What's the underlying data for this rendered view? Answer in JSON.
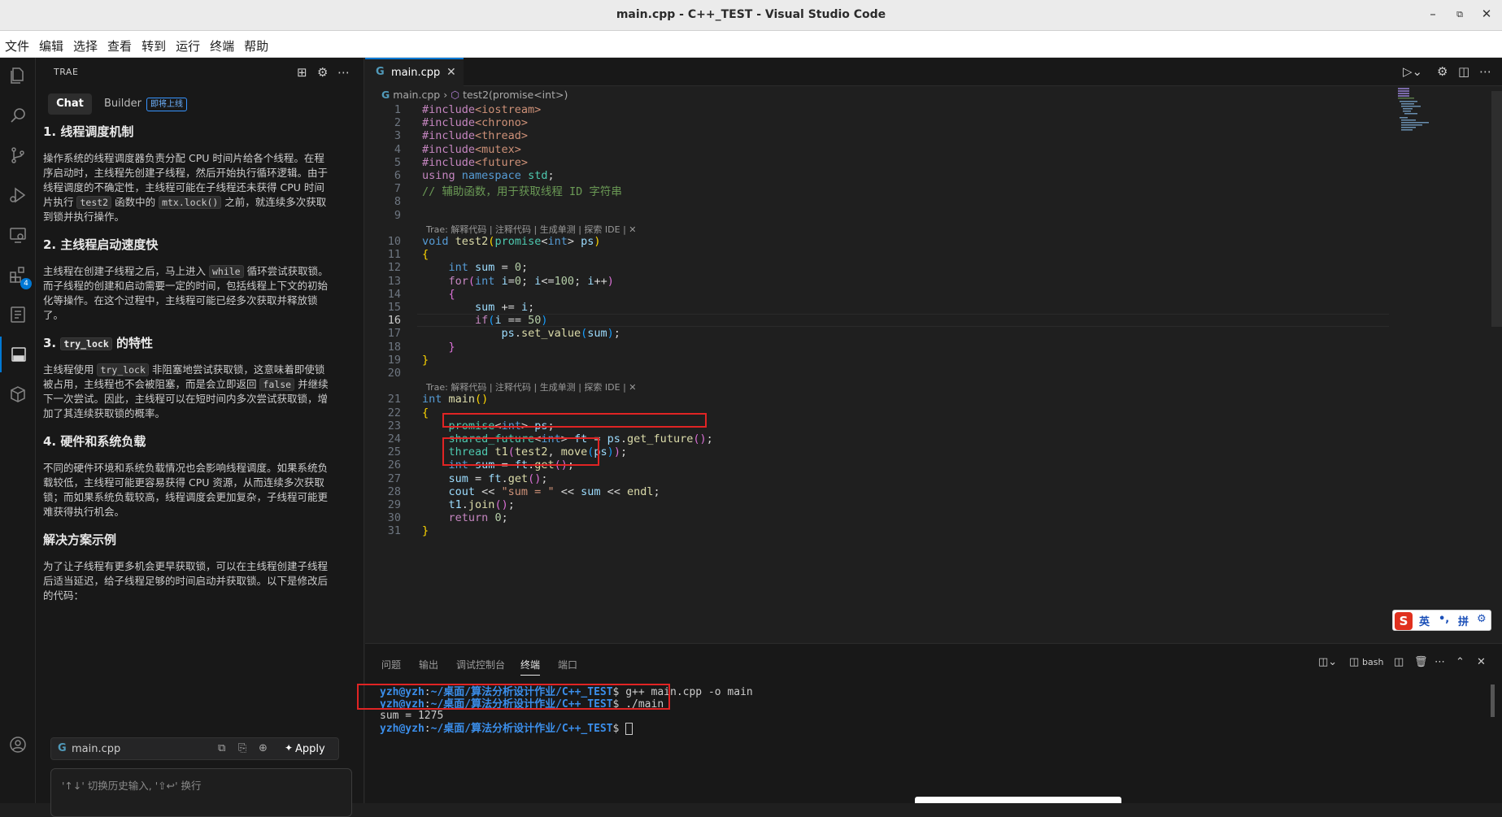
{
  "window": {
    "title": "main.cpp - C++_TEST - Visual Studio Code"
  },
  "menu": [
    "文件",
    "编辑",
    "选择",
    "查看",
    "转到",
    "运行",
    "终端",
    "帮助"
  ],
  "activity_badge": "4",
  "side": {
    "header": "TRAE",
    "tabs": {
      "chat": "Chat",
      "builder": "Builder",
      "builder_badge": "即将上线"
    },
    "sections": [
      {
        "title": "1. 线程调度机制",
        "body": [
          "操作系统的线程调度器负责分配 CPU 时间片给各个线程。在程序启动时，主线程先创建子线程，然后开始执行循环逻辑。由于线程调度的不确定性，主线程可能在子线程还未获得 CPU 时间片执行 ",
          "test2",
          " 函数中的 ",
          "mtx.lock()",
          " 之前，就连续多次获取到锁并执行操作。"
        ]
      },
      {
        "title": "2. 主线程启动速度快",
        "body": [
          "主线程在创建子线程之后，马上进入 ",
          "while",
          " 循环尝试获取锁。而子线程的创建和启动需要一定的时间，包括线程上下文的初始化等操作。在这个过程中，主线程可能已经多次获取并释放锁了。"
        ]
      },
      {
        "title_pre": "3. ",
        "title_code": "try_lock",
        "title_post": " 的特性",
        "body": [
          "主线程使用 ",
          "try_lock",
          " 非阻塞地尝试获取锁，这意味着即使锁被占用，主线程也不会被阻塞，而是会立即返回 ",
          "false",
          " 并继续下一次尝试。因此，主线程可以在短时间内多次尝试获取锁，增加了其连续获取锁的概率。"
        ]
      },
      {
        "title": "4. 硬件和系统负载",
        "body": [
          "不同的硬件环境和系统负载情况也会影响线程调度。如果系统负载较低，主线程可能更容易获得 CPU 资源，从而连续多次获取锁；而如果系统负载较高，线程调度会更加复杂，子线程可能更难获得执行机会。"
        ]
      },
      {
        "title": "解决方案示例",
        "body": [
          "为了让子线程有更多机会更早获取锁，可以在主线程创建子线程后适当延迟，给子线程足够的时间启动并获取锁。以下是修改后的代码："
        ]
      }
    ],
    "code_block": {
      "filename": "main.cpp",
      "apply": "Apply"
    },
    "input_placeholder": "'↑↓' 切换历史输入, '⇧↩' 换行"
  },
  "editor": {
    "tab": "main.cpp",
    "breadcrumb": {
      "file": "main.cpp",
      "symbol": "test2(promise<int>)"
    },
    "codelens": "Trae: 解释代码 | 注释代码 | 生成单测 | 探索 IDE | ✕",
    "current_line": 16,
    "lines": [
      {
        "n": "1",
        "html": "<span class='kc'>#include</span><span class='s'>&lt;iostream&gt;</span>"
      },
      {
        "n": "2",
        "html": "<span class='kc'>#include</span><span class='s'>&lt;chrono&gt;</span>"
      },
      {
        "n": "3",
        "html": "<span class='kc'>#include</span><span class='s'>&lt;thread&gt;</span>"
      },
      {
        "n": "4",
        "html": "<span class='kc'>#include</span><span class='s'>&lt;mutex&gt;</span>"
      },
      {
        "n": "5",
        "html": "<span class='kc'>#include</span><span class='s'>&lt;future&gt;</span>"
      },
      {
        "n": "6",
        "html": "<span class='kc'>using</span> <span class='k'>namespace</span> <span class='t'>std</span>;"
      },
      {
        "n": "7",
        "html": "<span class='c'>// 辅助函数，用于获取线程 ID 字符串</span>"
      },
      {
        "n": "8",
        "html": ""
      },
      {
        "n": "9",
        "html": ""
      },
      {
        "n": "10",
        "html": "<span class='k'>void</span> <span class='f'>test2</span><span class='p1'>(</span><span class='t'>promise</span>&lt;<span class='k'>int</span>&gt; <span class='v'>ps</span><span class='p1'>)</span>"
      },
      {
        "n": "11",
        "html": "<span class='p1'>{</span>"
      },
      {
        "n": "12",
        "html": "    <span class='k'>int</span> <span class='v'>sum</span> = <span class='n'>0</span>;"
      },
      {
        "n": "13",
        "html": "    <span class='kc'>for</span><span class='p2'>(</span><span class='k'>int</span> <span class='v'>i</span>=<span class='n'>0</span>; <span class='v'>i</span>&lt;=<span class='n'>100</span>; <span class='v'>i</span>++<span class='p2'>)</span>"
      },
      {
        "n": "14",
        "html": "    <span class='p2'>{</span>"
      },
      {
        "n": "15",
        "html": "        <span class='v'>sum</span> += <span class='v'>i</span>;"
      },
      {
        "n": "16",
        "html": "        <span class='kc'>if</span><span class='p3'>(</span><span class='v'>i</span> == <span class='n'>50</span><span class='p3'>)</span>"
      },
      {
        "n": "17",
        "html": "            <span class='v'>ps</span>.<span class='f'>set_value</span><span class='p3'>(</span><span class='v'>sum</span><span class='p3'>)</span>;"
      },
      {
        "n": "18",
        "html": "    <span class='p2'>}</span>"
      },
      {
        "n": "19",
        "html": "<span class='p1'>}</span>"
      },
      {
        "n": "20",
        "html": ""
      },
      {
        "n": "21",
        "html": "<span class='k'>int</span> <span class='f'>main</span><span class='p1'>()</span>"
      },
      {
        "n": "22",
        "html": "<span class='p1'>{</span>"
      },
      {
        "n": "23",
        "html": "    <span class='t'>promise</span>&lt;<span class='k'>int</span>&gt; <span class='v'>ps</span>;"
      },
      {
        "n": "24",
        "html": "    <span class='t'>shared_future</span>&lt;<span class='k'>int</span>&gt; <span class='v'>ft</span> = <span class='v'>ps</span>.<span class='f'>get_future</span><span class='p2'>()</span>;"
      },
      {
        "n": "25",
        "html": "    <span class='t'>thread</span> <span class='f'>t1</span><span class='p2'>(</span><span class='f'>test2</span>, <span class='f'>move</span><span class='p3'>(</span><span class='v'>ps</span><span class='p3'>)</span><span class='p2'>)</span>;"
      },
      {
        "n": "26",
        "html": "    <span class='k'>int</span> <span class='v'>sum</span> = <span class='v'>ft</span>.<span class='f'>get</span><span class='p2'>()</span>;"
      },
      {
        "n": "27",
        "html": "    <span class='v'>sum</span> = <span class='v'>ft</span>.<span class='f'>get</span><span class='p2'>()</span>;"
      },
      {
        "n": "28",
        "html": "    <span class='v'>cout</span> &lt;&lt; <span class='s'>\"sum = \"</span> &lt;&lt; <span class='v'>sum</span> &lt;&lt; <span class='f'>endl</span>;"
      },
      {
        "n": "29",
        "html": "    <span class='v'>t1</span>.<span class='f'>join</span><span class='p2'>()</span>;"
      },
      {
        "n": "30",
        "html": "    <span class='kc'>return</span> <span class='n'>0</span>;"
      },
      {
        "n": "31",
        "html": "<span class='p1'>}</span>"
      }
    ]
  },
  "ime": {
    "lang": "英",
    "punct": "•,",
    "mode": "拼"
  },
  "panel": {
    "tabs": [
      "问题",
      "输出",
      "调试控制台",
      "终端",
      "端口"
    ],
    "active_tab": "终端",
    "shell": "bash",
    "terminal": [
      {
        "user": "yzh@yzh",
        "path": "~/桌面/算法分析设计作业/C++_TEST",
        "cmd": "$ g++ main.cpp -o main"
      },
      {
        "user": "yzh@yzh",
        "path": "~/桌面/算法分析设计作业/C++_TEST",
        "cmd": "$ ./main"
      },
      {
        "output": "sum = 1275"
      },
      {
        "user": "yzh@yzh",
        "path": "~/桌面/算法分析设计作业/C++_TEST",
        "cmd": "$ "
      }
    ]
  }
}
